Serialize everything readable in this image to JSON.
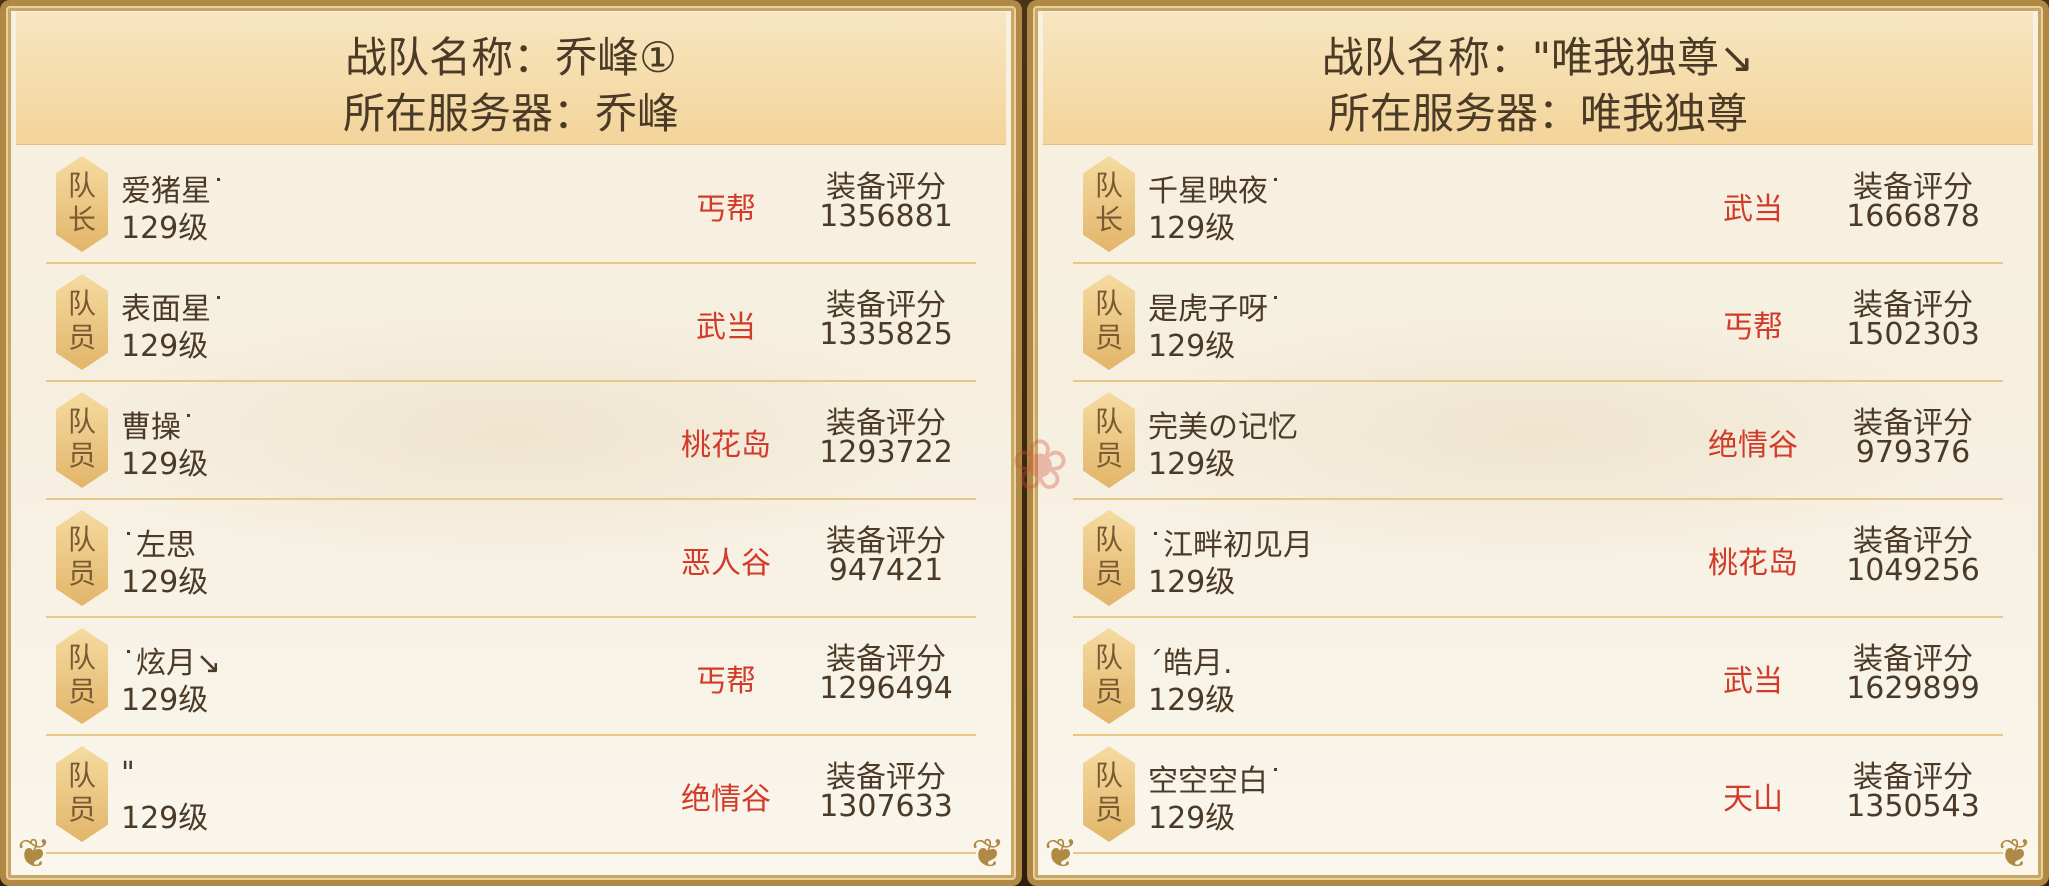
{
  "teams": [
    {
      "team_name_line": "战队名称：乔峰①",
      "server_line": "所在服务器：乔峰",
      "members": [
        {
          "role": [
            "队",
            "长"
          ],
          "name": "爱猪星˙",
          "level": "129级",
          "sect": "丐帮",
          "score_label": "装备评分",
          "score": "1356881"
        },
        {
          "role": [
            "队",
            "员"
          ],
          "name": "表面星˙",
          "level": "129级",
          "sect": "武当",
          "score_label": "装备评分",
          "score": "1335825"
        },
        {
          "role": [
            "队",
            "员"
          ],
          "name": "曹操˙",
          "level": "129级",
          "sect": "桃花岛",
          "score_label": "装备评分",
          "score": "1293722"
        },
        {
          "role": [
            "队",
            "员"
          ],
          "name": "˙左思",
          "level": "129级",
          "sect": "恶人谷",
          "score_label": "装备评分",
          "score": "947421"
        },
        {
          "role": [
            "队",
            "员"
          ],
          "name": "˙炫月↘",
          "level": "129级",
          "sect": "丐帮",
          "score_label": "装备评分",
          "score": "1296494"
        },
        {
          "role": [
            "队",
            "员"
          ],
          "name": "\"",
          "level": "129级",
          "sect": "绝情谷",
          "score_label": "装备评分",
          "score": "1307633"
        }
      ]
    },
    {
      "team_name_line": "战队名称：\"唯我独尊↘",
      "server_line": "所在服务器：唯我独尊",
      "members": [
        {
          "role": [
            "队",
            "长"
          ],
          "name": "千星映夜˙",
          "level": "129级",
          "sect": "武当",
          "score_label": "装备评分",
          "score": "1666878"
        },
        {
          "role": [
            "队",
            "员"
          ],
          "name": "是虎子呀˙",
          "level": "129级",
          "sect": "丐帮",
          "score_label": "装备评分",
          "score": "1502303"
        },
        {
          "role": [
            "队",
            "员"
          ],
          "name": "完美の记忆",
          "level": "129级",
          "sect": "绝情谷",
          "score_label": "装备评分",
          "score": "979376"
        },
        {
          "role": [
            "队",
            "员"
          ],
          "name": "˙江畔初见月",
          "level": "129级",
          "sect": "桃花岛",
          "score_label": "装备评分",
          "score": "1049256"
        },
        {
          "role": [
            "队",
            "员"
          ],
          "name": "´皓月.",
          "level": "129级",
          "sect": "武当",
          "score_label": "装备评分",
          "score": "1629899"
        },
        {
          "role": [
            "队",
            "员"
          ],
          "name": "空空空白˙",
          "level": "129级",
          "sect": "天山",
          "score_label": "装备评分",
          "score": "1350543"
        }
      ]
    }
  ],
  "colors": {
    "sect_text": "#d23b2a",
    "body_text": "#4a3a26",
    "frame": "#b08a45"
  },
  "icons": {
    "corner": "ornament-corner-icon",
    "role_badge": "hexagon-badge-icon",
    "watermark": "game-logo-watermark"
  }
}
